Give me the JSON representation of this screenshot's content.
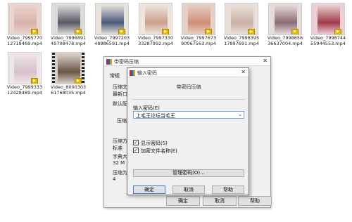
{
  "files": [
    {
      "name": "Video_7995770\n12718469.mp4",
      "color": "#d7b3aa",
      "bg": "#ead4cf"
    },
    {
      "name": "Video_7996891\n45708478.mp4",
      "color": "#5a5a66",
      "bg": "#dcdcdc"
    },
    {
      "name": "Video_7997203\n48986591.mp4",
      "color": "#4a5a7a",
      "bg": "#e7e2dc"
    },
    {
      "name": "Video_7997330\n33287992.mp4",
      "color": "#caa08c",
      "bg": "#efe5df"
    },
    {
      "name": "Video_7997673\n90067563.mp4",
      "color": "#cf8f77",
      "bg": "#e6cfc4"
    },
    {
      "name": "Video_7998395\n17897691.mp4",
      "color": "#c9b0a4",
      "bg": "#e9e0da"
    },
    {
      "name": "Video_7998656\n36637004.mp4",
      "color": "#8a6d74",
      "bg": "#e7dcdc"
    },
    {
      "name": "Video_7998744\n55944553.mp4",
      "color": "#a23a4a",
      "bg": "#ead0d4"
    },
    {
      "name": "Video_7999333\n12428489.mp4",
      "color": "#d7c0c8",
      "bg": "#eee6ea"
    },
    {
      "name": "Video_8000303\n61768035.mp4",
      "color": "#6a5444",
      "bg": "#d8d0c8",
      "film": true
    }
  ],
  "back_dialog": {
    "title": "带密码压缩",
    "tab": "常规",
    "labels": [
      "压缩文",
      "最新口",
      "默认配",
      "压缩",
      "压缩方",
      "标准",
      "字典大",
      "32 M",
      "压缩为",
      "4"
    ],
    "buttons": {
      "ok": "确定",
      "cancel": "取消",
      "help": "帮助"
    }
  },
  "dialog": {
    "title": "输入密码",
    "section_title": "带密码压缩",
    "password_label": "输入密码(E)",
    "password_value": "上毛王论坛当毛王",
    "show_password": "显示密码(S)",
    "encrypt_names": "加密文件名称(E)",
    "manage_button": "管理密码(O)...",
    "ok_button": "确定",
    "cancel_button": "取消",
    "help_button": "帮助"
  }
}
